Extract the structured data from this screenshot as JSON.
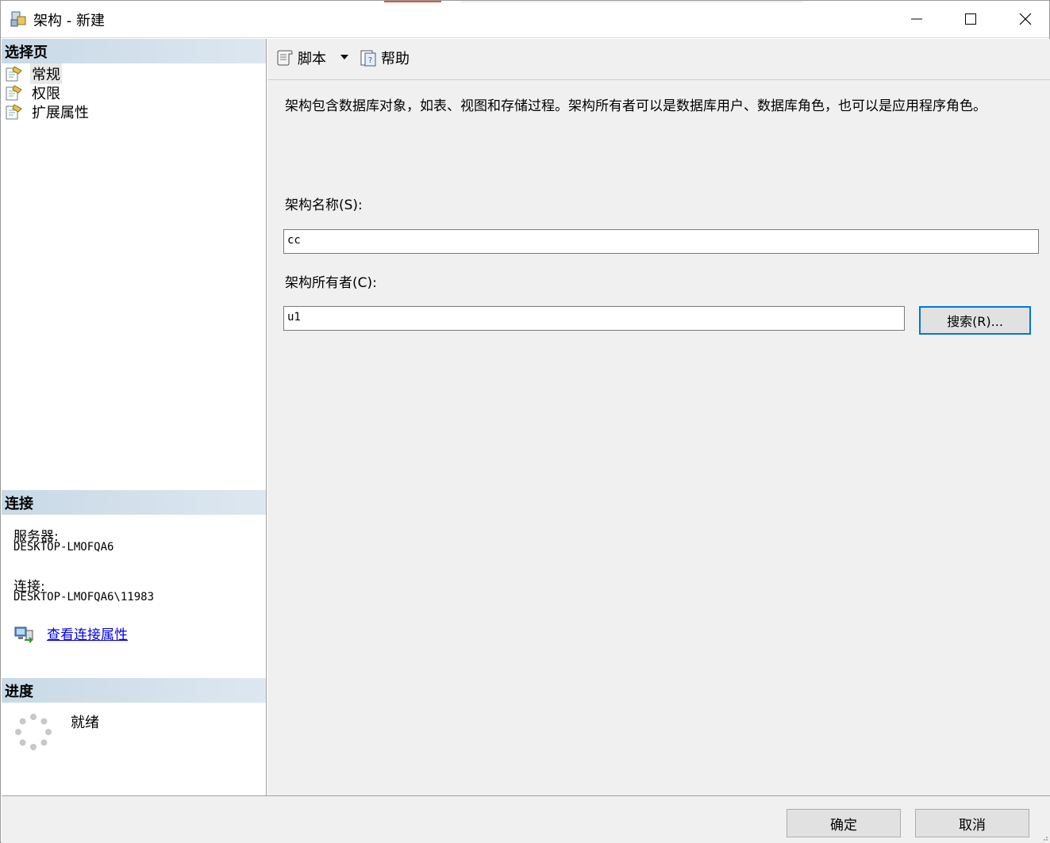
{
  "window": {
    "title": "架构 - 新建"
  },
  "left_panel": {
    "select_page": {
      "header": "选择页",
      "items": [
        {
          "label": "常规",
          "icon": "page-settings-icon",
          "selected": true
        },
        {
          "label": "权限",
          "icon": "page-settings-icon",
          "selected": false
        },
        {
          "label": "扩展属性",
          "icon": "page-settings-icon",
          "selected": false
        }
      ]
    },
    "connection": {
      "header": "连接",
      "server_label": "服务器:",
      "server_value": "DESKTOP-LMOFQA6",
      "connection_label": "连接:",
      "connection_value": "DESKTOP-LMOFQA6\\11983",
      "view_properties_link": "查看连接属性",
      "link_icon": "connection-properties-icon"
    },
    "progress": {
      "header": "进度",
      "status": "就绪",
      "icon": "spinner-icon"
    }
  },
  "toolbar": {
    "script_label": "脚本",
    "help_label": "帮助"
  },
  "main": {
    "description": "架构包含数据库对象，如表、视图和存储过程。架构所有者可以是数据库用户、数据库角色，也可以是应用程序角色。",
    "schema_name_label": "架构名称(S):",
    "schema_name_value": "cc",
    "schema_owner_label": "架构所有者(C):",
    "schema_owner_value": "u1",
    "search_button": "搜索(R)..."
  },
  "footer": {
    "ok_label": "确定",
    "cancel_label": "取消"
  },
  "colors": {
    "section_header": "#c9d9e7",
    "link": "#0000ee",
    "focus_border": "#0078d7",
    "panel_bg": "#f0f0f0"
  }
}
